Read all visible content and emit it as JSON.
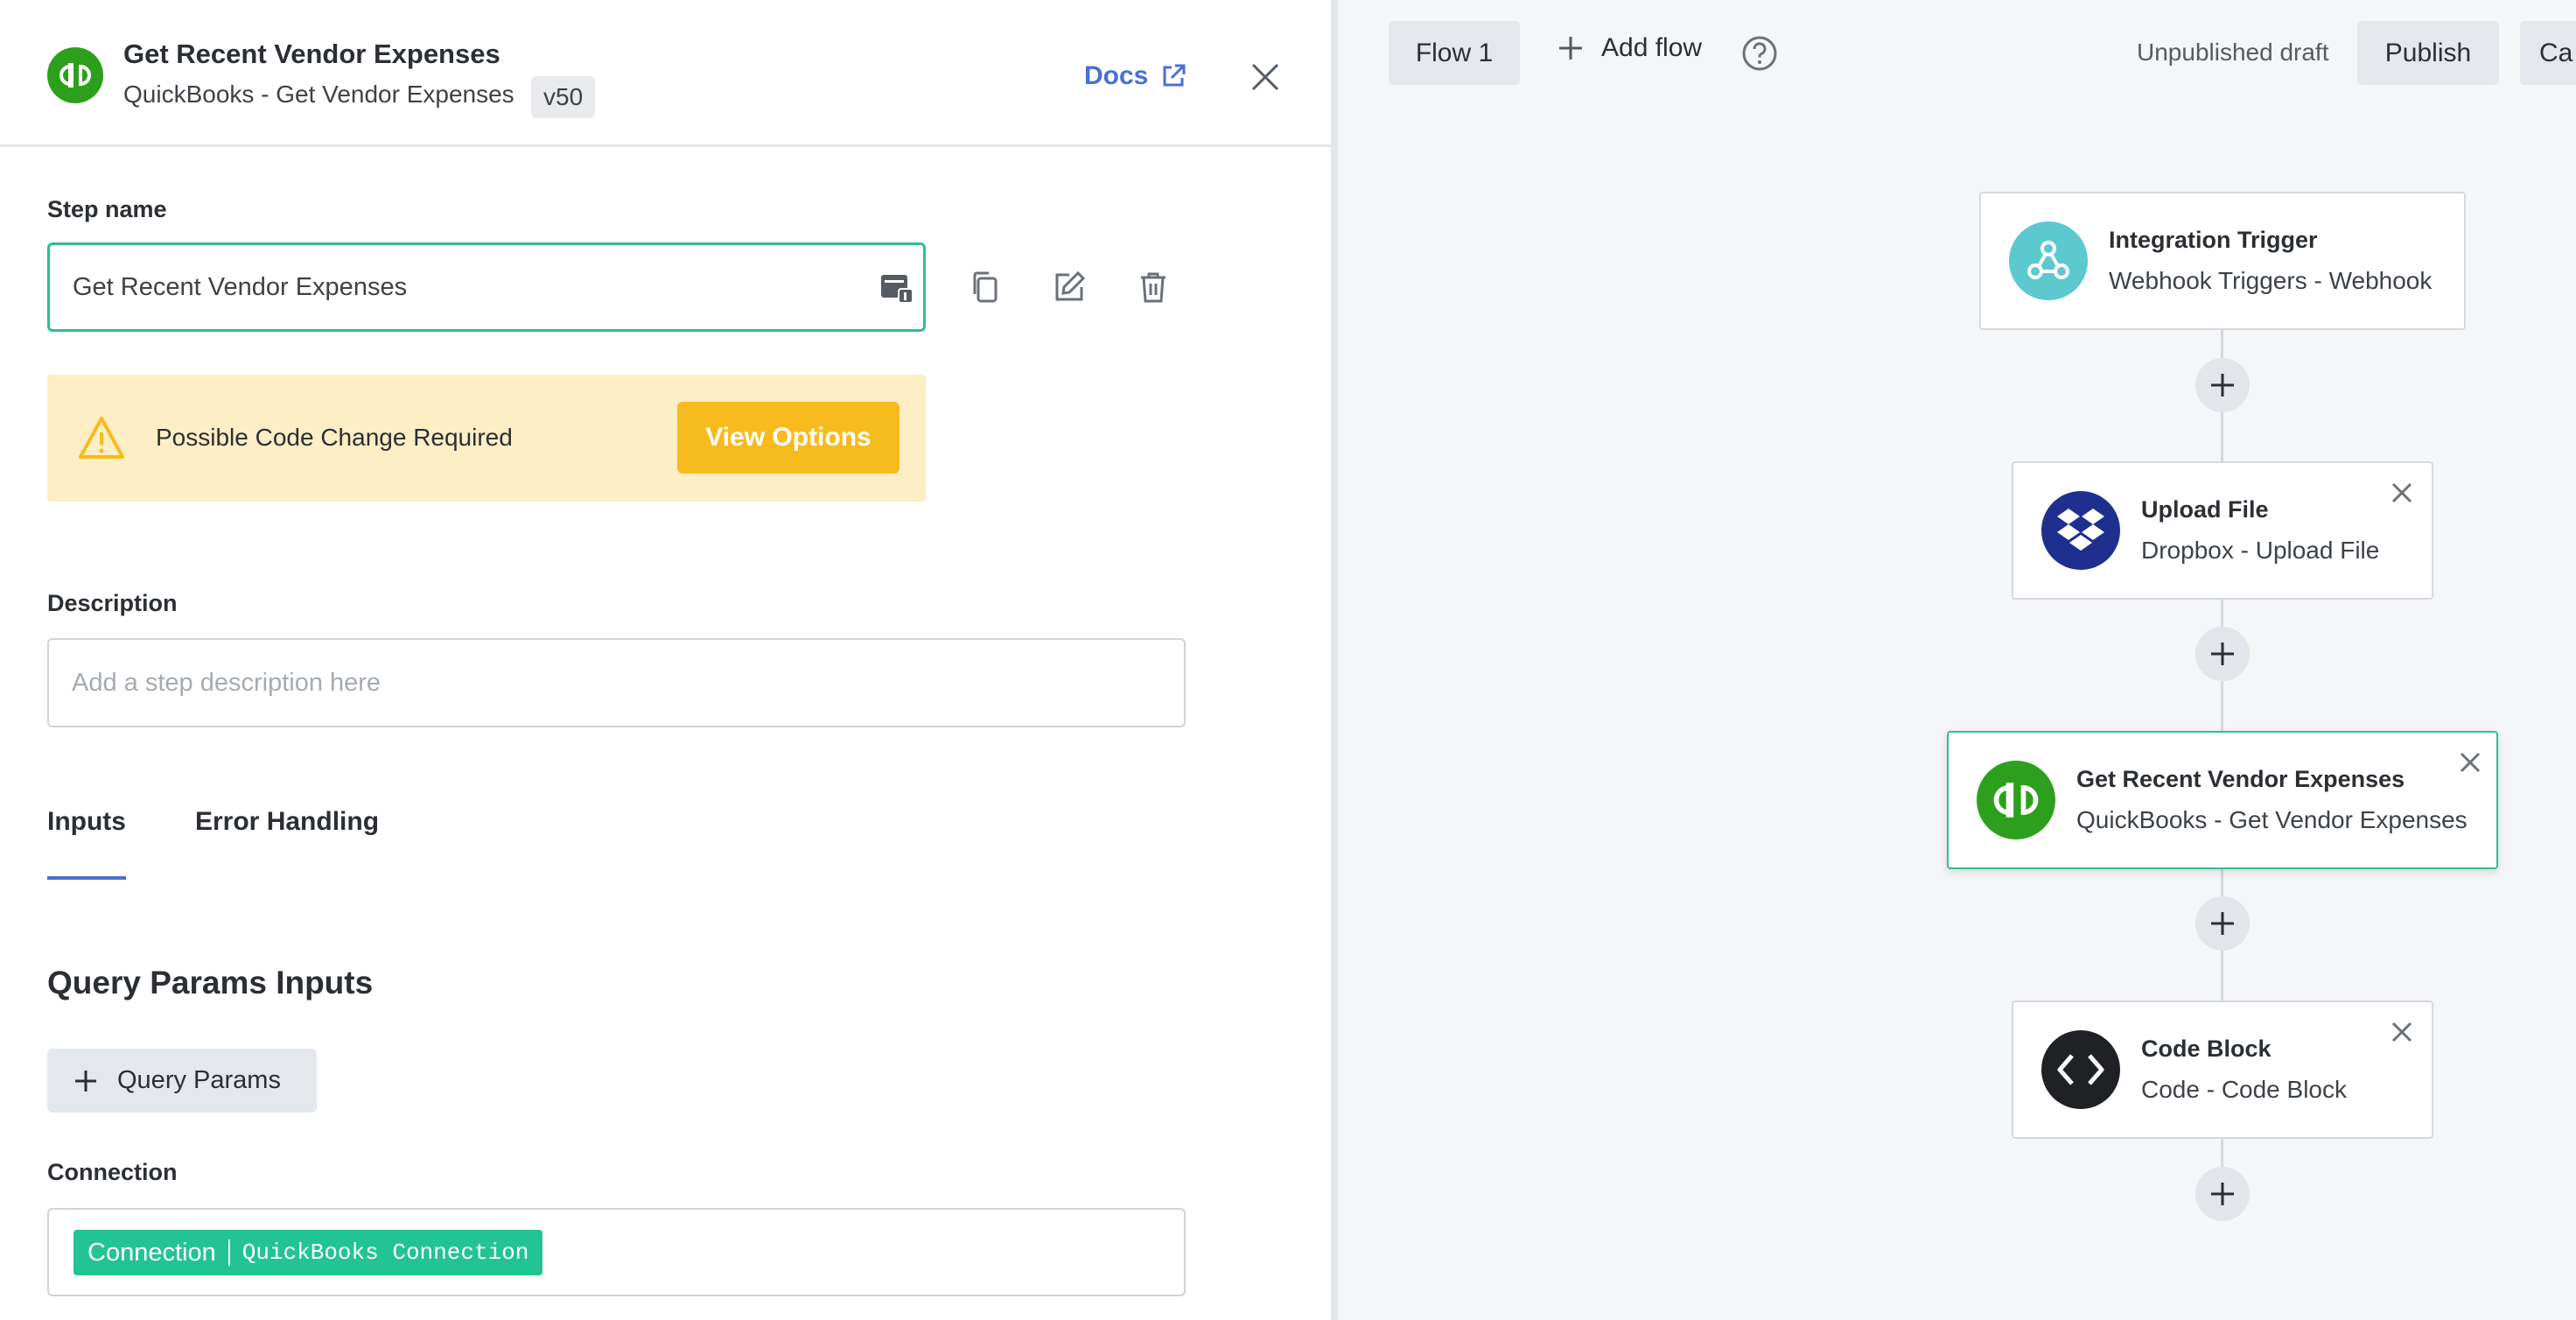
{
  "header": {
    "title": "Get Recent Vendor Expenses",
    "subtitle": "QuickBooks - Get Vendor Expenses",
    "version": "v50",
    "docs_label": "Docs"
  },
  "step_name": {
    "label": "Step name",
    "value": "Get Recent Vendor Expenses"
  },
  "warning": {
    "text": "Possible Code Change Required",
    "button_label": "View Options"
  },
  "description": {
    "label": "Description",
    "placeholder": "Add a step description here"
  },
  "tabs": [
    {
      "label": "Inputs",
      "active": true
    },
    {
      "label": "Error Handling",
      "active": false
    }
  ],
  "inputs_section": {
    "title": "Query Params Inputs",
    "add_button_label": "Query Params"
  },
  "connection": {
    "label": "Connection",
    "tag_type": "Connection",
    "tag_value": "QuickBooks Connection"
  },
  "canvas_toolbar": {
    "flow_tab": "Flow 1",
    "add_flow_label": "Add flow",
    "draft_status": "Unpublished draft",
    "publish_label": "Publish",
    "cancel_label": "Ca"
  },
  "flow_nodes": [
    {
      "title": "Integration Trigger",
      "subtitle": "Webhook Triggers - Webhook",
      "icon": "webhook-icon"
    },
    {
      "title": "Upload File",
      "subtitle": "Dropbox - Upload File",
      "icon": "dropbox-icon"
    },
    {
      "title": "Get Recent Vendor Expenses",
      "subtitle": "QuickBooks - Get Vendor Expenses",
      "icon": "quickbooks-icon",
      "active": true
    },
    {
      "title": "Code Block",
      "subtitle": "Code - Code Block",
      "icon": "code-icon"
    }
  ],
  "colors": {
    "accent_green": "#2fbf91",
    "quickbooks_green": "#2ca01c",
    "warning_bg": "#fdeec6",
    "warning_button": "#f7bb1d",
    "link_blue": "#4a6fd6",
    "connection_tag": "#22c493",
    "dropbox_blue": "#1f2f8f",
    "webhook_teal": "#5cc9cf"
  }
}
